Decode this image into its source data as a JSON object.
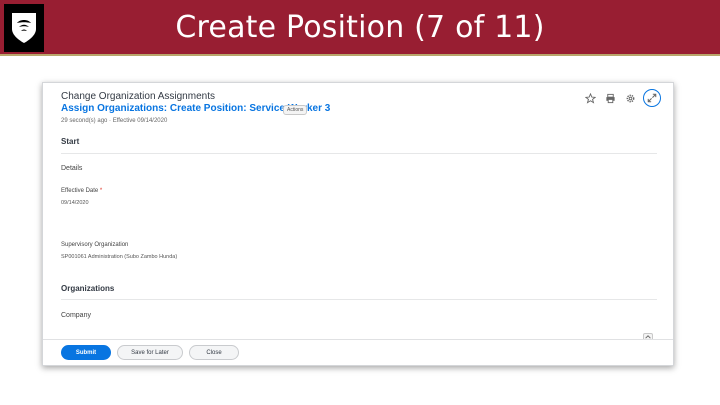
{
  "slide": {
    "title": "Create Position (7 of 11)"
  },
  "task": {
    "title": "Change Organization Assignments",
    "subtitle": "Assign Organizations: Create Position: Service Worker 3",
    "tag": "Actions",
    "meta": "29 second(s) ago · Effective 09/14/2020"
  },
  "icons": {
    "favorite": "star-icon",
    "print": "printer-icon",
    "settings": "gear-icon",
    "expand": "expand-icon"
  },
  "sections": {
    "start": "Start",
    "details": "Details",
    "organizations": "Organizations"
  },
  "fields": {
    "effective_date_label": "Effective Date",
    "required_marker": "*",
    "effective_date_value": "09/14/2020",
    "supervisory_org_label": "Supervisory Organization",
    "supervisory_org_value": "SP001061 Administration (Subo Zambo Hunda)",
    "company_label": "Company"
  },
  "buttons": {
    "submit": "Submit",
    "save_for_later": "Save for Later",
    "close": "Close"
  },
  "colors": {
    "header_band": "#981e32",
    "accent": "#0875e1",
    "required": "#de2e21"
  }
}
